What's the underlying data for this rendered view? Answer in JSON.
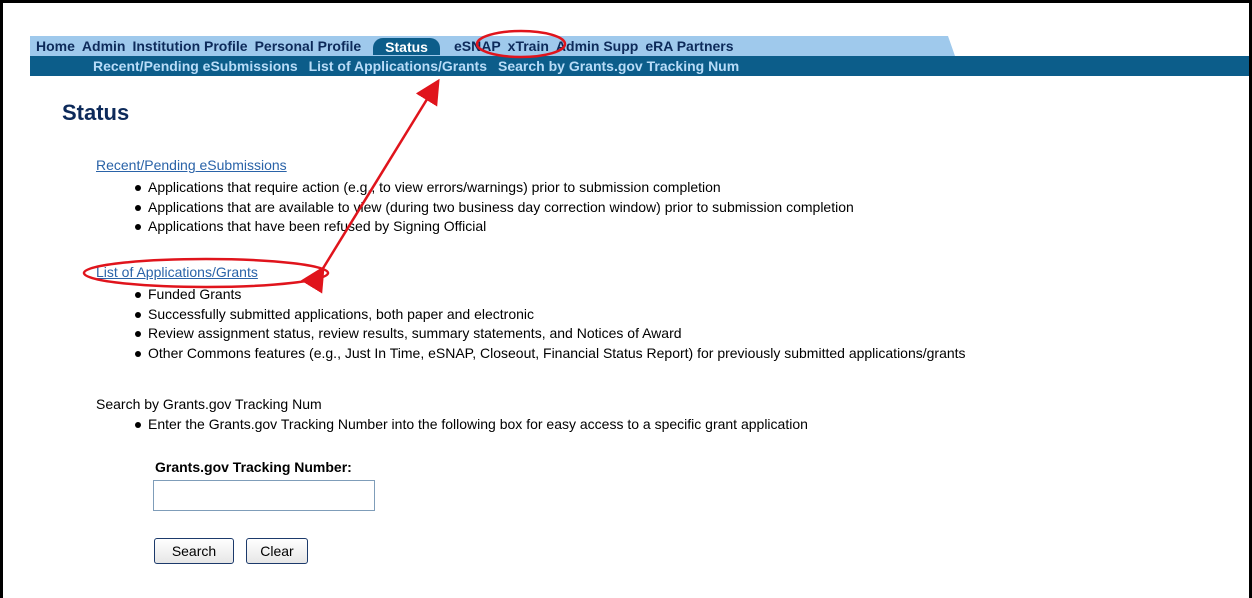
{
  "nav": {
    "tabs": [
      {
        "label": "Home"
      },
      {
        "label": "Admin"
      },
      {
        "label": "Institution Profile"
      },
      {
        "label": "Personal Profile"
      },
      {
        "label": "Status"
      },
      {
        "label": "eSNAP"
      },
      {
        "label": "xTrain"
      },
      {
        "label": "Admin Supp"
      },
      {
        "label": "eRA Partners"
      }
    ],
    "active_tab": "Status",
    "subtabs": [
      {
        "label": "Recent/Pending eSubmissions"
      },
      {
        "label": "List of Applications/Grants"
      },
      {
        "label": "Search by Grants.gov Tracking Num"
      }
    ]
  },
  "page": {
    "title": "Status"
  },
  "sections": {
    "recent": {
      "title": "Recent/Pending eSubmissions",
      "items": [
        "Applications that require action (e.g., to view errors/warnings) prior to submission completion",
        "Applications that are available to view (during two business day correction window) prior to submission completion",
        "Applications that have been refused by Signing Official"
      ]
    },
    "list": {
      "title": "List of Applications/Grants",
      "items": [
        "Funded Grants",
        "Successfully submitted applications, both paper and electronic",
        "Review assignment status, review results, summary statements, and Notices of Award",
        "Other Commons features (e.g., Just In Time, eSNAP, Closeout, Financial Status Report) for previously submitted applications/grants"
      ]
    },
    "search": {
      "title": "Search by Grants.gov Tracking Num",
      "items": [
        "Enter the Grants.gov Tracking Number into the following box for easy access to a specific grant application"
      ]
    }
  },
  "form": {
    "tracking_label": "Grants.gov Tracking Number:",
    "tracking_value": "",
    "search_label": "Search",
    "clear_label": "Clear"
  },
  "colors": {
    "nav_light": "#9fc9ec",
    "nav_dark": "#0c5d8a",
    "link": "#2a63a8",
    "annotation": "#e0141c"
  }
}
